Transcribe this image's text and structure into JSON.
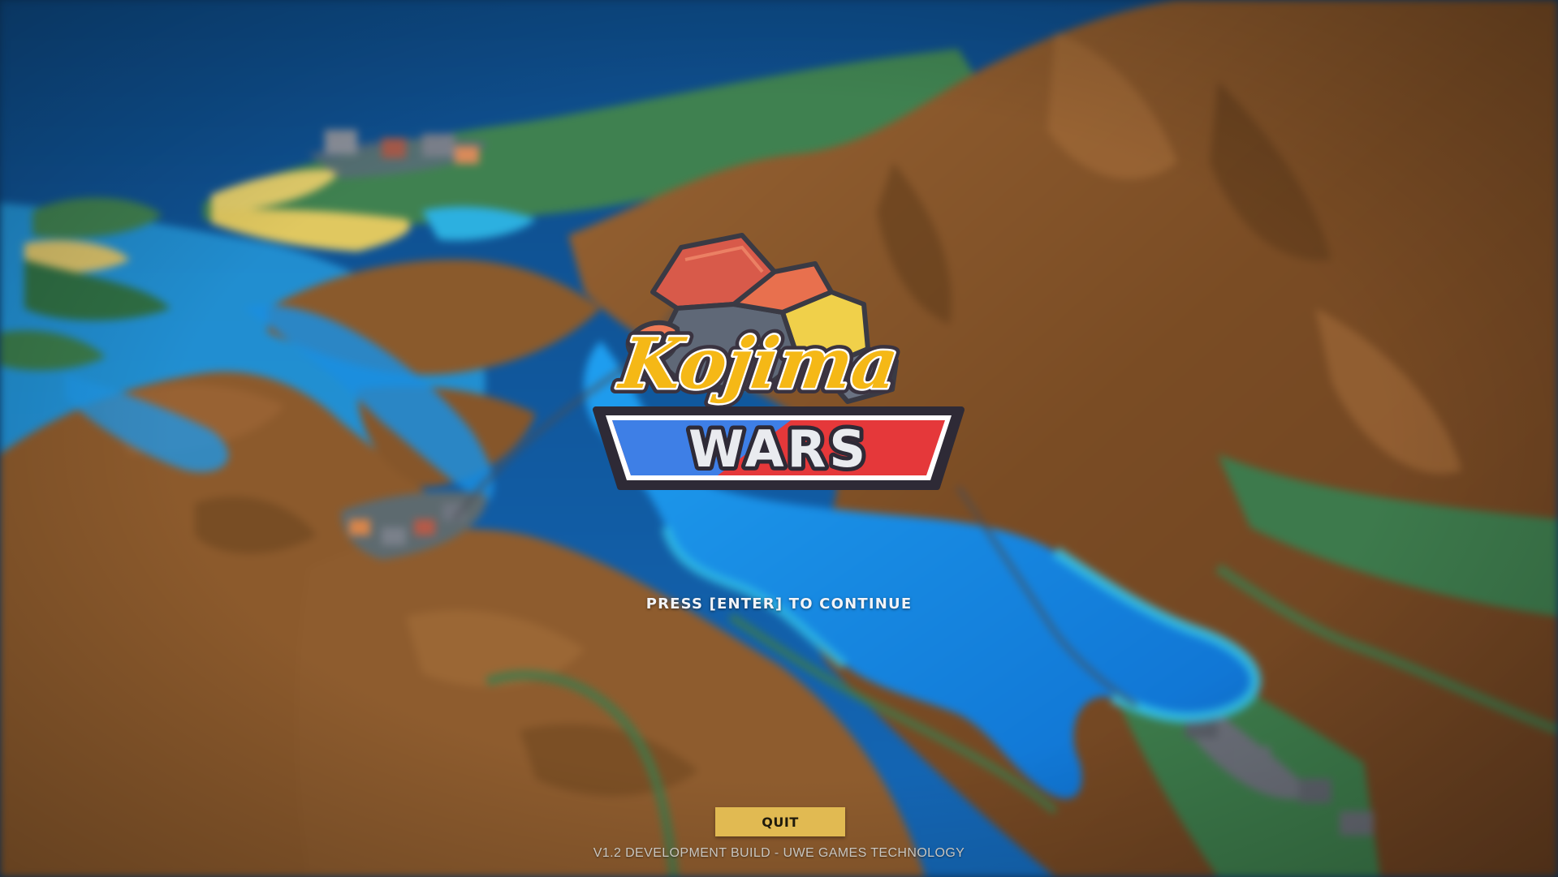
{
  "logo": {
    "title_top": "Kojima",
    "title_bottom": "WARS"
  },
  "prompt": {
    "text": "PRESS [ENTER] TO CONTINUE"
  },
  "menu": {
    "quit_label": "QUIT"
  },
  "footer": {
    "version_text": "V1.2 DEVELOPMENT BUILD - UWE GAMES TECHNOLOGY"
  },
  "colors": {
    "ocean_deep": "#0f4f8f",
    "lake": "#1a8ee6",
    "terrain_brown": "#8a5a2e",
    "grass": "#3f7f4f",
    "button_gold": "#e1ba52",
    "logo_yellow": "#f5c518",
    "logo_red": "#e23a3a",
    "logo_blue": "#3b7de0"
  }
}
